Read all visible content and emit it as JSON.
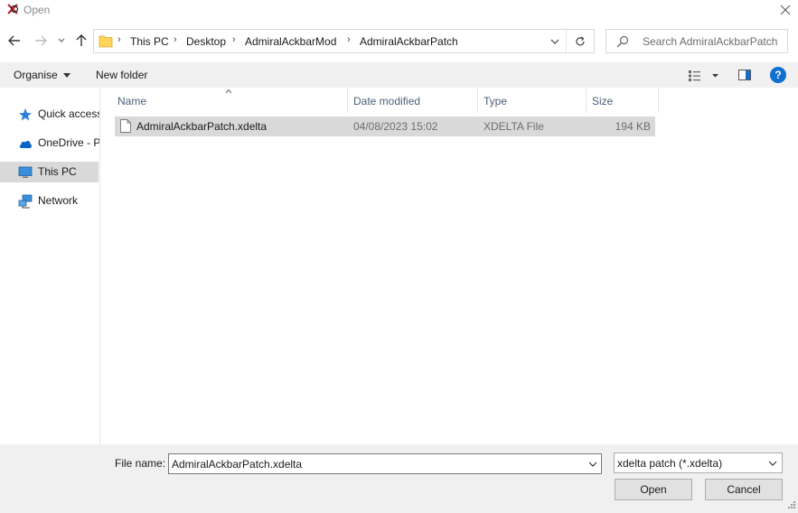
{
  "window": {
    "title": "Open"
  },
  "address": {
    "crumbs": [
      "This PC",
      "Desktop",
      "AdmiralAckbarMod",
      "AdmiralAckbarPatch"
    ]
  },
  "search": {
    "placeholder": "Search AdmiralAckbarPatch"
  },
  "toolbar": {
    "organise_label": "Organise",
    "new_folder_label": "New folder",
    "help_label": "?"
  },
  "sidebar": {
    "items": [
      {
        "label": "Quick access",
        "icon": "star-icon"
      },
      {
        "label": "OneDrive - P",
        "icon": "cloud-icon"
      },
      {
        "label": "This PC",
        "icon": "computer-icon",
        "selected": true
      },
      {
        "label": "Network",
        "icon": "network-icon"
      }
    ]
  },
  "filelist": {
    "columns": [
      "Name",
      "Date modified",
      "Type",
      "Size"
    ],
    "rows": [
      {
        "name": "AdmiralAckbarPatch.xdelta",
        "date": "04/08/2023 15:02",
        "type": "XDELTA File",
        "size": "194 KB",
        "selected": true
      }
    ]
  },
  "bottom": {
    "file_name_label": "File name:",
    "file_name_value": "AdmiralAckbarPatch.xdelta",
    "filter_value": "xdelta patch (*.xdelta)",
    "open_label": "Open",
    "cancel_label": "Cancel"
  },
  "colors": {
    "accent": "#1170cf",
    "selection": "#d9d9d9",
    "header_text": "#4c607a",
    "folder": "#ffd55a"
  }
}
